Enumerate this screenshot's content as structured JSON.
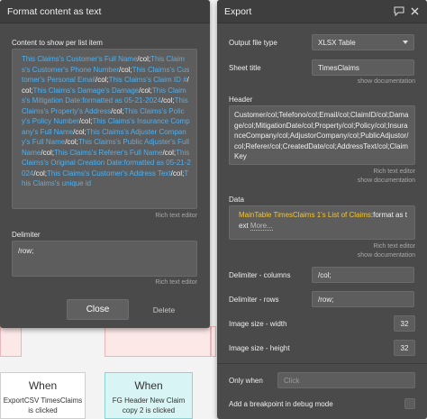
{
  "left_panel": {
    "title": "Format content as text",
    "content_label": "Content to show per list item",
    "content_tokens": [
      {
        "t": "This Claims's Customer's Full Name",
        "d": 1
      },
      {
        "t": "/col;",
        "d": 0
      },
      {
        "t": "This Claims's Customer's Phone Number",
        "d": 1
      },
      {
        "t": "/col;",
        "d": 0
      },
      {
        "t": "This Claims's Customer's Personal Email",
        "d": 1
      },
      {
        "t": "/col;",
        "d": 0
      },
      {
        "t": "This Claims's Claim ID #",
        "d": 1
      },
      {
        "t": "/col;",
        "d": 0
      },
      {
        "t": "This Claims's Damage's Damage",
        "d": 1
      },
      {
        "t": "/col;",
        "d": 0
      },
      {
        "t": "This Claims's Mitigation Date:formatted as 05-21-2024",
        "d": 1
      },
      {
        "t": "/col;",
        "d": 0
      },
      {
        "t": "This Claims's Property's Address",
        "d": 1
      },
      {
        "t": "/col;",
        "d": 0
      },
      {
        "t": "This Claims's Policy's Policy Number",
        "d": 1
      },
      {
        "t": "/col;",
        "d": 0
      },
      {
        "t": "This Claims's Insurance Company's Full Name",
        "d": 1
      },
      {
        "t": "/col;",
        "d": 0
      },
      {
        "t": "This Claims's Adjuster Company's Full Name",
        "d": 1
      },
      {
        "t": "/col;",
        "d": 0
      },
      {
        "t": "This Claims's Public Adjuster's Full Name",
        "d": 1
      },
      {
        "t": "/col;",
        "d": 0
      },
      {
        "t": "This Claims's Referer's Full Name",
        "d": 1
      },
      {
        "t": "/col;",
        "d": 0
      },
      {
        "t": "This Claims's Original Creation Date:formatted as 05-21-2024",
        "d": 1
      },
      {
        "t": "/col;",
        "d": 0
      },
      {
        "t": "This Claims's Customer's Address Text",
        "d": 1
      },
      {
        "t": "/col;",
        "d": 0
      },
      {
        "t": "This Claims's unique id",
        "d": 1
      }
    ],
    "content_hint": "Rich text editor",
    "delimiter_label": "Delimiter",
    "delimiter_value": "/row;",
    "delimiter_hint": "Rich text editor",
    "close_label": "Close",
    "delete_label": "Delete"
  },
  "right_panel": {
    "title": "Export",
    "output_type_label": "Output file type",
    "output_type_value": "XLSX Table",
    "sheet_title_label": "Sheet title",
    "sheet_title_value": "TimesClaims",
    "show_documentation": "show documentation",
    "header_label": "Header",
    "header_value": "Customer/col;Telefono/col;Email/col;ClaimID/col;Damage/col;MitigationDate/col;Property/col;Policy/col;InsuranceCompany/col;AdjustorCompany/col;PublicAdjustor/col;Referer/col;CreatedDate/col;AddressText/col;ClaimKey",
    "header_hint": "Rich text editor",
    "data_label": "Data",
    "data_dynamic": "MainTable TimesClaims 1's List of Claims",
    "data_suffix": ":format as text",
    "data_more": "More...",
    "data_hint": "Rich text editor",
    "delim_cols_label": "Delimiter - columns",
    "delim_cols_value": "/col;",
    "delim_rows_label": "Delimiter - rows",
    "delim_rows_value": "/row;",
    "img_width_label": "Image size - width",
    "img_width_value": "32",
    "img_height_label": "Image size - height",
    "img_height_value": "32",
    "only_when_label": "Only when",
    "only_when_placeholder": "Click",
    "breakpoint_label": "Add a breakpoint in debug mode"
  },
  "background": {
    "when_cards": [
      {
        "title": "When",
        "text": "ExportCSV TimesClaims is clicked"
      },
      {
        "title": "When",
        "text": "FG Header New Claim copy 2 is clicked"
      }
    ]
  },
  "colors": {
    "panel_bg": "#4a4a4a",
    "dynamic_blue": "#4fb0f0",
    "dynamic_yellow": "#f3c630"
  }
}
